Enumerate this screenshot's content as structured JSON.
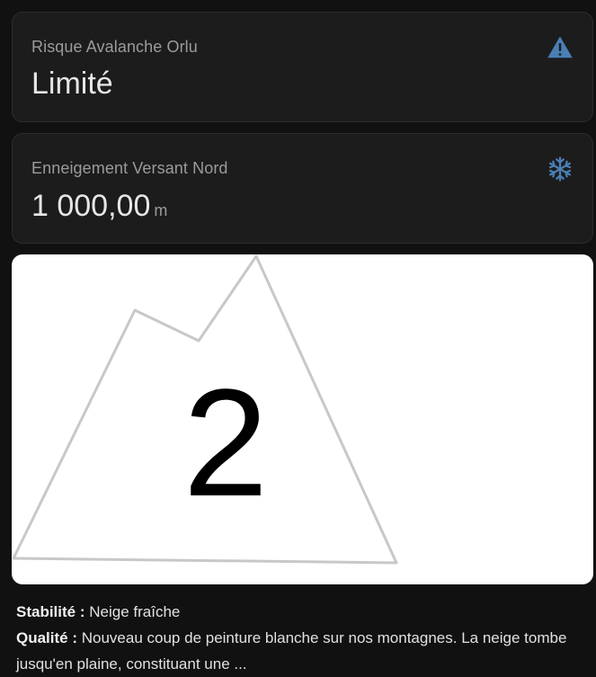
{
  "avalanche_card": {
    "name": "Risque Avalanche Orlu",
    "value": "Limité",
    "icon": "warning-icon",
    "icon_color": "#4a7fb5"
  },
  "snow_card": {
    "name": "Enneigement Versant Nord",
    "value": "1 000,00",
    "unit": "m",
    "icon": "snowflake-icon",
    "icon_color": "#4a7fb5"
  },
  "risk_image": {
    "level": "2"
  },
  "info": {
    "stability_label": "Stabilité :",
    "stability_value": "Neige fraîche",
    "quality_label": "Qualité :",
    "quality_value": "Nouveau coup de peinture blanche sur nos montagnes. La neige tombe jusqu'en plaine, constituant une ..."
  }
}
